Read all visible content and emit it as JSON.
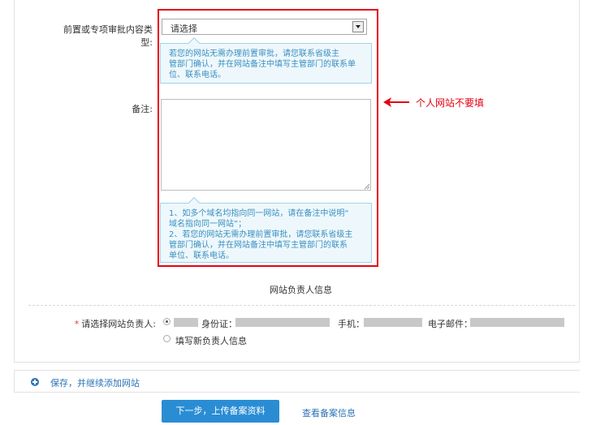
{
  "form": {
    "type_label": "前置或专项审批内容类型:",
    "type_select_value": "请选择",
    "type_tip": [
      "若您的网站无需办理前置审批，请您联系省级主",
      "管部门确认，并在网站备注中填写主管部门的联系单",
      "位、联系电话。"
    ],
    "note_label": "备注:",
    "note_value": "",
    "note_tip": [
      "1、如多个域名均指向同一网站，请在备注中说明“",
      "域名指向同一网站”；",
      "2、若您的网站无需办理前置审批，请您联系省级主",
      "管部门确认，并在网站备注中填写主管部门的联系",
      "单位、联系电话。"
    ]
  },
  "annotation": {
    "text": "个人网站不要填",
    "color": "#e50012"
  },
  "owner_section": {
    "title": "网站负责人信息",
    "required_mark": "*",
    "owner_label": "请选择网站负责人:",
    "option_existing": {
      "id_label": "身份证：",
      "phone_label": "手机：",
      "email_label": "电子邮件：",
      "selected": true
    },
    "option_new_label": "填写新负责人信息"
  },
  "footer": {
    "add_link": "保存，并继续添加网站",
    "next_button": "下一步，上传备案资料",
    "view_link": "查看备案信息"
  },
  "colors": {
    "accent_blue": "#2a8dd4",
    "link_blue": "#2b73b6",
    "tip_text": "#3a8fc0",
    "tip_bg": "#eef8fc"
  }
}
